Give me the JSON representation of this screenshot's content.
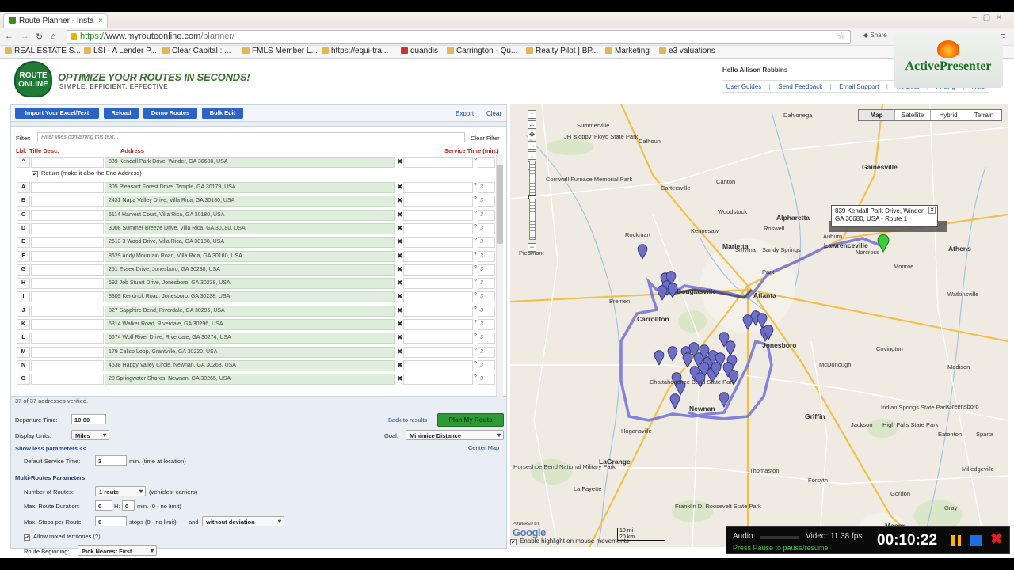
{
  "browser": {
    "tab_title": "Route Planner - Insta",
    "url_prefix": "https://",
    "url_host": "www.myrouteonline.com",
    "url_path": "/planner/",
    "share_label": "Share",
    "bookmarks": [
      "REAL ESTATE S...",
      "LSI - A Lender P...",
      "Clear Capital : ...",
      "FMLS Member L...",
      "https://equi-tra...",
      "quandis",
      "Carrington - Qu...",
      "Realty Pilot | BP...",
      "Marketing",
      "e3 valuations"
    ]
  },
  "watermark": {
    "title": "ActivePresenter"
  },
  "site": {
    "logo_text_1": "ROUTE",
    "logo_text_2": "ONLINE",
    "tagline": "OPTIMIZE YOUR ROUTES IN SECONDS!",
    "subtagline": "SIMPLE. EFFICIENT. EFFECTIVE",
    "greeting": "Hello Allison Robbins",
    "links": [
      "User Guides",
      "Send Feedback",
      "Email Support",
      "Try Beta",
      "Pricing",
      "Help"
    ]
  },
  "toolbar": {
    "import_label": "Import Your Excel/Text",
    "reload_label": "Reload",
    "demo_label": "Demo Routes",
    "bulk_label": "Bulk Edit",
    "export_label": "Export",
    "clear_label": "Clear"
  },
  "filter": {
    "label": "Filter:",
    "placeholder": "Filter lines containing this text...",
    "clear_label": "Clear Filter"
  },
  "columns": {
    "lbl": "Lbl.",
    "title": "Title Desc.",
    "address": "Address",
    "service": "Service Time (min.)"
  },
  "start_row": {
    "label": "^",
    "address": "839 Kendall Park Drive, Winder, GA 30680, USA"
  },
  "return_label": "Return (make it also the End Address)",
  "rows": [
    {
      "label": "A",
      "address": "305 Pleasant Forest Drive, Temple, GA 30179, USA",
      "service": "3"
    },
    {
      "label": "B",
      "address": "2431 Napa Valley Drive, Villa Rica, GA 30180, USA",
      "service": "3"
    },
    {
      "label": "C",
      "address": "5114 Harvest Court, Villa Rica, GA 30180, USA",
      "service": "3"
    },
    {
      "label": "D",
      "address": "3008 Summer Breeze Drive, Villa Rica, GA 30180, USA",
      "service": "3"
    },
    {
      "label": "E",
      "address": "2613 3 Wood Drive, Villa Rica, GA 30180, USA",
      "service": "3"
    },
    {
      "label": "F",
      "address": "8629 Andy Mountain Road, Villa Rica, GA 30180, USA",
      "service": "3"
    },
    {
      "label": "G",
      "address": "251 Essex Drive, Jonesboro, GA 30238, USA",
      "service": "3"
    },
    {
      "label": "H",
      "address": "692 Jeb Stuart Drive, Jonesboro, GA 30238, USA",
      "service": "3"
    },
    {
      "label": "I",
      "address": "8309 Kendrick Road, Jonesboro, GA 30238, USA",
      "service": "3"
    },
    {
      "label": "J",
      "address": "327 Sapphire Bend, Riverdale, GA 30296, USA",
      "service": "3"
    },
    {
      "label": "K",
      "address": "6314 Walker Road, Riverdale, GA 30296, USA",
      "service": "3"
    },
    {
      "label": "L",
      "address": "6674 Wolf River Drive, Riverdale, GA 30274, USA",
      "service": "3"
    },
    {
      "label": "M",
      "address": "179 Calico Loop, Grantville, GA 30220, USA",
      "service": "3"
    },
    {
      "label": "N",
      "address": "4638 Happy Valley Circle, Newnan, GA 30263, USA",
      "service": "3"
    },
    {
      "label": "O",
      "address": "20 Springwater Shores, Newnan, GA 30265, USA",
      "service": "3"
    }
  ],
  "verified": "37 of 37 addresses verified.",
  "params": {
    "departure_label": "Departure Time:",
    "departure_value": "10:00",
    "units_label": "Display Units:",
    "units_value": "Miles",
    "show_less": "Show less parameters <<",
    "default_service_label": "Default Service Time:",
    "default_service_value": "3",
    "default_service_unit": "min. (time at location)",
    "back_results": "Back to results",
    "plan_label": "Plan My Route",
    "goal_label": "Goal:",
    "goal_value": "Minimize Distance",
    "center_map": "Center Map",
    "multi_header": "Multi-Routes Parameters",
    "num_routes_label": "Number of Routes:",
    "num_routes_value": "1 route",
    "num_routes_unit": "(vehicles, carriers)",
    "max_duration_label": "Max. Route Duration:",
    "max_duration_h": "0",
    "h_label": "H:",
    "max_duration_m": "0",
    "max_duration_unit": "min. (0 - no limit)",
    "max_stops_label": "Max. Stops per Route:",
    "max_stops_value": "0",
    "max_stops_unit": "stops (0 - no limit)",
    "and_label": "and",
    "deviation_value": "without deviation",
    "mixed_label": "Allow mixed territories",
    "mixed_help": "(?)",
    "route_begin_label": "Route Beginning:",
    "route_begin_value": "Pick Nearest First"
  },
  "map": {
    "types": [
      "Map",
      "Satellite",
      "Hybrid",
      "Terrain"
    ],
    "active_type": "Map",
    "bubble_line1": "839 Kendall Park Drive, Winder,",
    "bubble_line2": "GA 30680, USA - Route 1",
    "google": "Google",
    "scale_mi": "10 mi",
    "scale_km": "20 km",
    "powered": "POWERED BY",
    "places": [
      "Summerville",
      "Dahlonega",
      "Calhoun",
      "Canton",
      "Gainesville",
      "Cartersville",
      "Woodstock",
      "Alpharetta",
      "Kennesaw",
      "Roswell",
      "Rockmart",
      "Marietta",
      "Smyrna",
      "Sandy Springs",
      "Lawrenceville",
      "Athens",
      "Atlanta",
      "Douglasville",
      "Monroe",
      "Watkinsville",
      "Bremen",
      "Carrollton",
      "Jonesboro",
      "McDonough",
      "Covington",
      "Madison",
      "Newnan",
      "Griffin",
      "Jackson",
      "Hogansville",
      "LaGrange",
      "Thomaston",
      "Forsyth",
      "Macon",
      "Milledgeville",
      "Greensboro",
      "Eatonton",
      "Piedmont",
      "Chattahoochee Bend State Park",
      "JH 'sloppy' Floyd State Park",
      "Cornwall Furnace Memorial Park",
      "Indian Springs State Park",
      "High Falls State Park",
      "Franklin D. Roosevelt State Park",
      "Horseshoe Bend National Military Park",
      "La Fayette",
      "Gray",
      "Auburn",
      "Norcross",
      "Park",
      "Gordon",
      "Sparta"
    ],
    "enable_highlight": "Enable highlight on mouse movements"
  },
  "recorder": {
    "audio": "Audio",
    "video": "Video: 11.38 fps",
    "hint": "Press Pause to pause/resume",
    "time": "00:10:22"
  }
}
